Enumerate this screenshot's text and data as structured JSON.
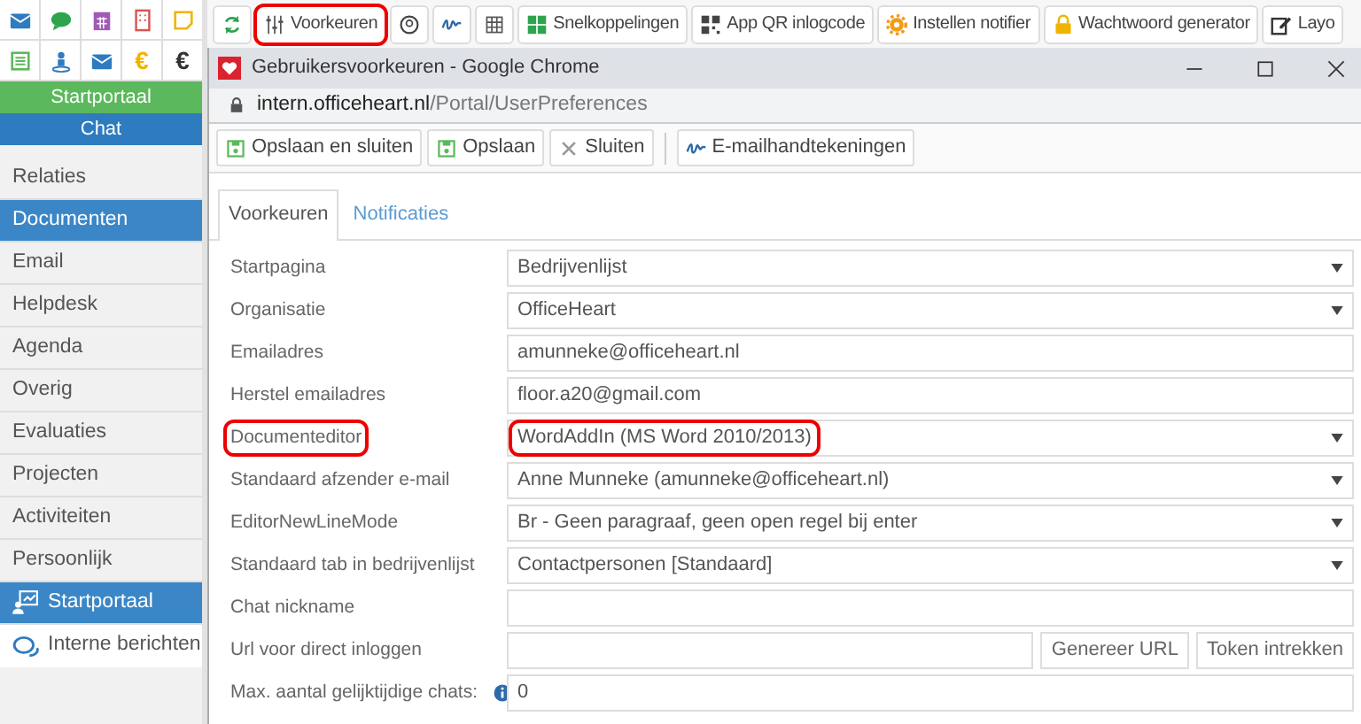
{
  "sidebar": {
    "tiles": [
      {
        "kind": "mail"
      },
      {
        "kind": "chat"
      },
      {
        "kind": "calendar"
      },
      {
        "kind": "building"
      },
      {
        "kind": "note"
      },
      {
        "kind": "list"
      },
      {
        "kind": "person"
      },
      {
        "kind": "mail"
      },
      {
        "kind": "glyph",
        "text": "€",
        "color": "#f0b400"
      },
      {
        "kind": "glyph",
        "text": "€",
        "color": "#333333"
      }
    ],
    "headers": [
      {
        "label": "Startportaal",
        "color": "#5cb85c"
      },
      {
        "label": "Chat",
        "color": "#2e7bbf"
      }
    ],
    "items": [
      {
        "label": "Relaties",
        "selected": false
      },
      {
        "label": "Documenten",
        "selected": true
      },
      {
        "label": "Email",
        "selected": false
      },
      {
        "label": "Helpdesk",
        "selected": false
      },
      {
        "label": "Agenda",
        "selected": false
      },
      {
        "label": "Overig",
        "selected": false
      },
      {
        "label": "Evaluaties",
        "selected": false
      },
      {
        "label": "Projecten",
        "selected": false
      },
      {
        "label": "Activiteiten",
        "selected": false
      },
      {
        "label": "Persoonlijk",
        "selected": false
      },
      {
        "label": "Startportaal",
        "selected": true
      },
      {
        "label": "Interne berichten",
        "selected": false
      }
    ]
  },
  "toolbar": [
    {
      "highlighted": false
    },
    {
      "label": "Voorkeuren",
      "highlighted": true
    },
    {
      "highlighted": false
    },
    {
      "highlighted": false
    },
    {
      "highlighted": false
    },
    {
      "label": "Snelkoppelingen",
      "highlighted": false
    },
    {
      "label": "App QR inlogcode",
      "highlighted": false
    },
    {
      "label": "Instellen notifier",
      "highlighted": false
    },
    {
      "label": "Wachtwoord generator",
      "highlighted": false
    },
    {
      "label": "Layo",
      "highlighted": false
    }
  ],
  "window": {
    "title": "Gebruikersvoorkeuren - Google Chrome",
    "url": {
      "host": "intern.officeheart.nl",
      "path": "/Portal/UserPreferences"
    },
    "buttons": [
      "Opslaan en sluiten",
      "Opslaan",
      "Sluiten",
      "E-mailhandtekeningen"
    ],
    "tabs": [
      {
        "label": "Voorkeuren",
        "selected": true
      },
      {
        "label": "Notificaties",
        "selected": false
      }
    ],
    "rows": [
      {
        "label": "Startpagina",
        "kind": "select",
        "value": "Bedrijvenlijst",
        "highlighted": false
      },
      {
        "label": "Organisatie",
        "kind": "select",
        "value": "OfficeHeart",
        "highlighted": false
      },
      {
        "label": "Emailadres",
        "kind": "text",
        "value": "amunneke@officeheart.nl",
        "highlighted": false
      },
      {
        "label": "Herstel emailadres",
        "kind": "text",
        "value": "floor.a20@gmail.com",
        "highlighted": false
      },
      {
        "label": "Documenteditor",
        "kind": "select",
        "value": "WordAddIn (MS Word 2010/2013)",
        "highlighted": true
      },
      {
        "label": "Standaard afzender e-mail",
        "kind": "select",
        "value": "Anne Munneke (amunneke@officeheart.nl)",
        "highlighted": false
      },
      {
        "label": "EditorNewLineMode",
        "kind": "select",
        "value": "Br - Geen paragraaf, geen open regel bij enter",
        "highlighted": false
      },
      {
        "label": "Standaard tab in bedrijvenlijst",
        "kind": "select",
        "value": "Contactpersonen [Standaard]",
        "highlighted": false
      },
      {
        "label": "Chat nickname",
        "kind": "text",
        "highlighted": false
      },
      {
        "label": "Url voor direct inloggen",
        "kind": "text",
        "buttons": [
          "Genereer URL",
          "Token intrekken"
        ],
        "highlighted": false
      },
      {
        "label": "Max. aantal gelijktijdige chats:",
        "kind": "text",
        "value": "0",
        "info": true,
        "highlighted": false
      }
    ]
  }
}
